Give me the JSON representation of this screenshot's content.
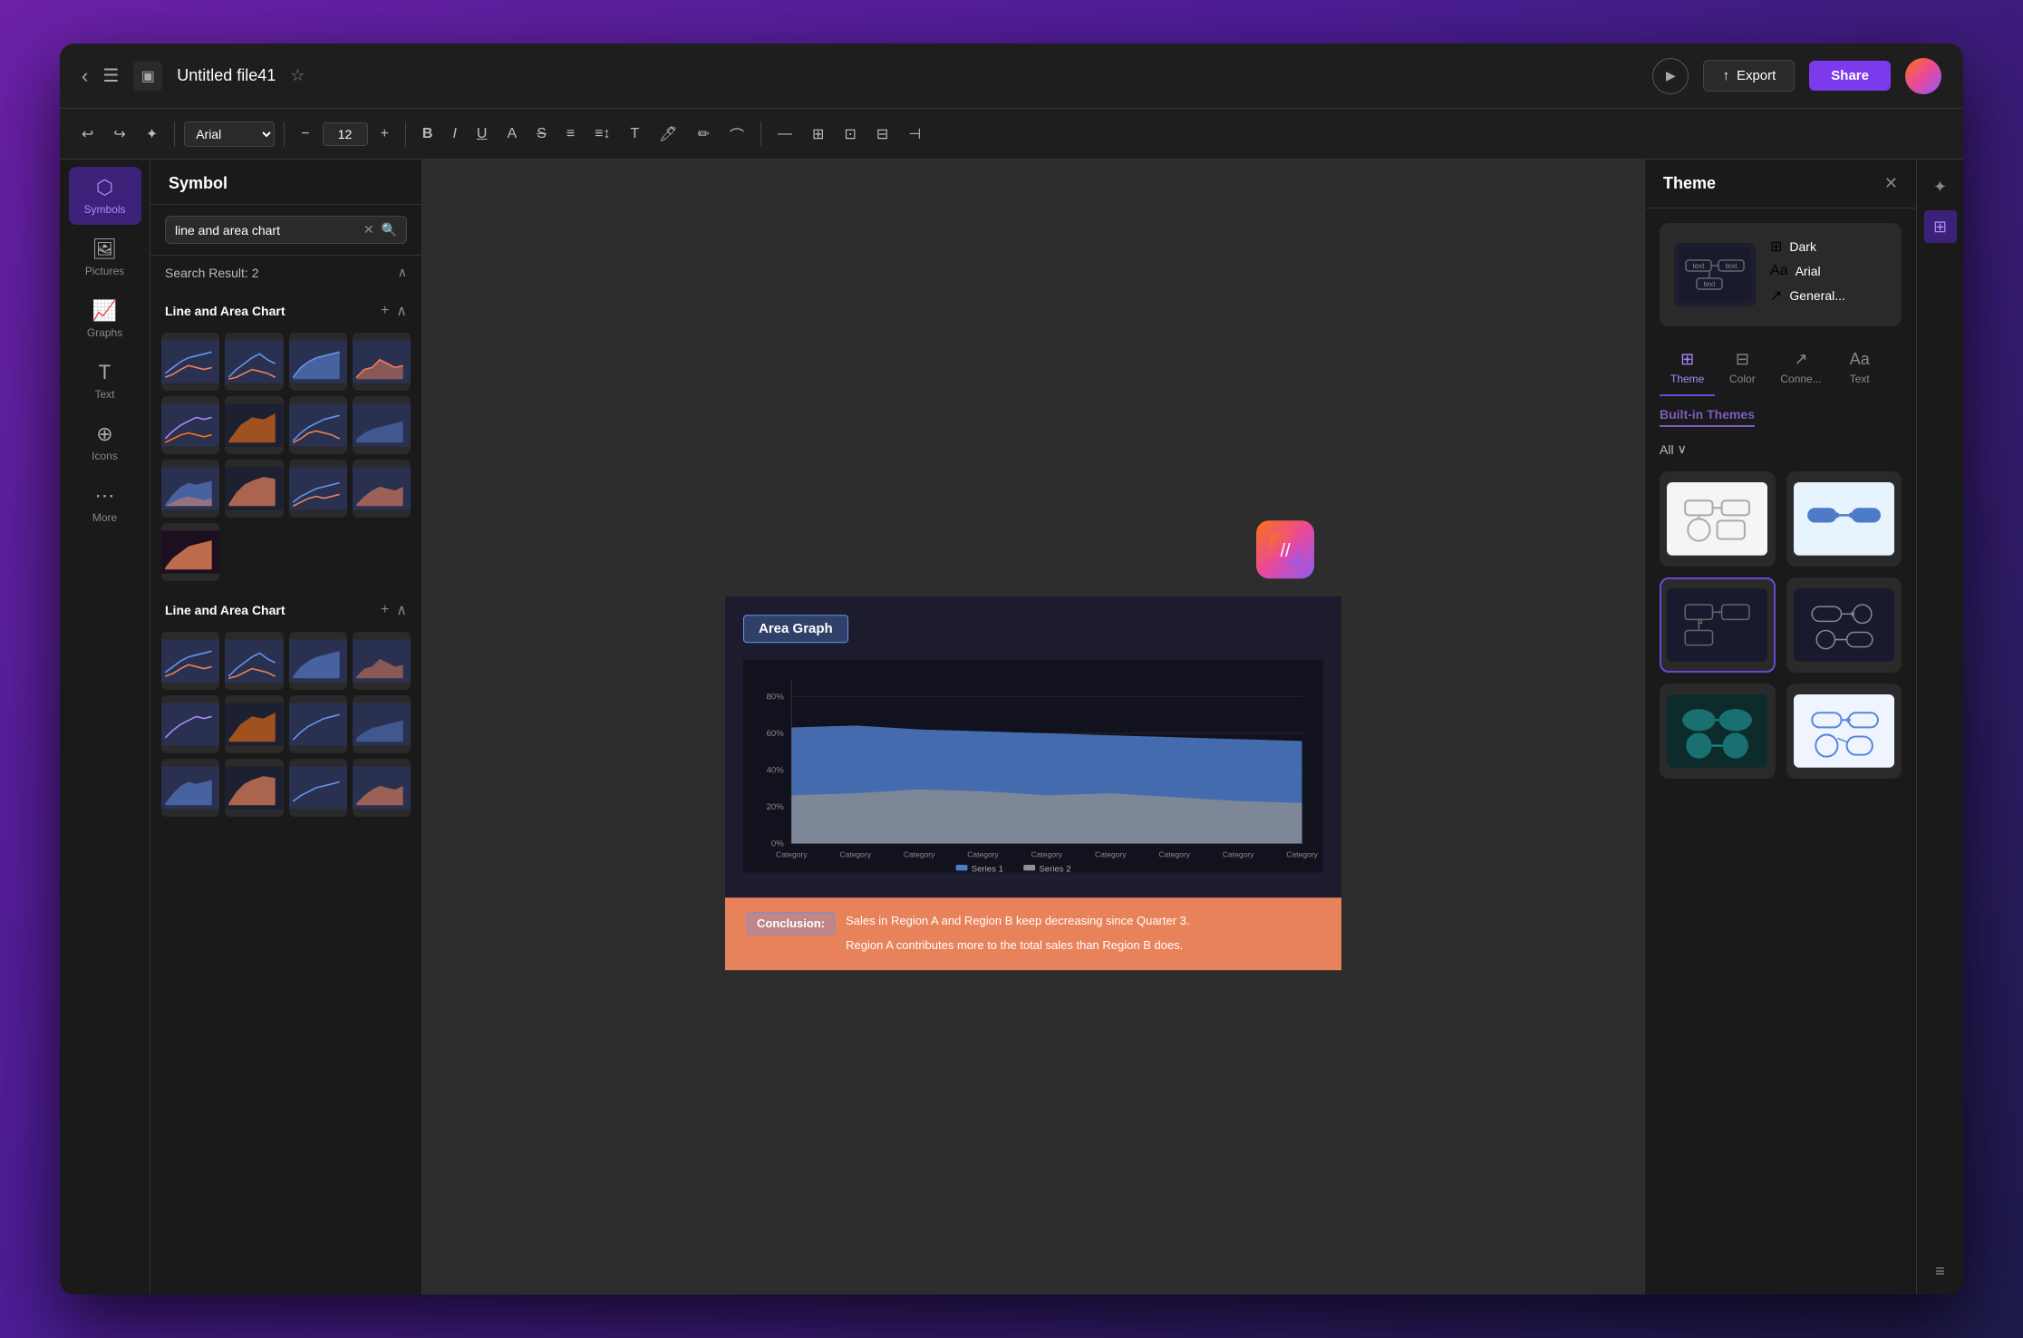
{
  "app": {
    "title": "Untitled file41",
    "window_title": "Untitled file41"
  },
  "titlebar": {
    "back_label": "‹",
    "menu_label": "☰",
    "file_title": "Untitled file41",
    "export_label": "Export",
    "share_label": "Share",
    "play_label": "▶"
  },
  "toolbar": {
    "undo_label": "↩",
    "redo_label": "↪",
    "magic_label": "✦",
    "font_value": "Arial",
    "font_size_value": "12",
    "bold_label": "B",
    "italic_label": "I",
    "underline_label": "U",
    "text_color_label": "A",
    "strikethrough_label": "S",
    "align_label": "≡",
    "indent_label": "⇥",
    "textbox_label": "T"
  },
  "left_nav": {
    "items": [
      {
        "id": "symbols",
        "icon": "⬡",
        "label": "Symbols",
        "active": true
      },
      {
        "id": "pictures",
        "icon": "🖼",
        "label": "Pictures",
        "active": false
      },
      {
        "id": "graphs",
        "icon": "📊",
        "label": "Graphs",
        "active": false
      },
      {
        "id": "text",
        "icon": "T",
        "label": "Text",
        "active": false
      },
      {
        "id": "icons",
        "icon": "⊕",
        "label": "Icons",
        "active": false
      },
      {
        "id": "more",
        "icon": "⋯",
        "label": "More",
        "active": false
      }
    ]
  },
  "symbol_panel": {
    "header": "Symbol",
    "search_value": "line and area chart",
    "search_placeholder": "line and area chart",
    "result_count": "Search Result: 2",
    "sections": [
      {
        "title": "Line and Area Chart",
        "id": "section1"
      },
      {
        "title": "Line and Area Chart",
        "id": "section2"
      }
    ]
  },
  "canvas": {
    "chart_title": "Area Graph",
    "conclusion_label": "Conclusion:",
    "conclusion_text": "Sales in Region A and Region B keep decreasing since Quarter 3.\n\nRegion A contributes more to the total sales than Region B does."
  },
  "theme_panel": {
    "title": "Theme",
    "close_label": "✕",
    "theme_name": "Dark",
    "font_name": "Arial",
    "connector_label": "General...",
    "tabs": [
      {
        "id": "theme",
        "icon": "⊞",
        "label": "Theme",
        "active": true
      },
      {
        "id": "color",
        "icon": "⊟",
        "label": "Color",
        "active": false
      },
      {
        "id": "connector",
        "icon": "↗",
        "label": "Conne...",
        "active": false
      },
      {
        "id": "text",
        "icon": "Aa",
        "label": "Text",
        "active": false
      }
    ],
    "builtin_themes_label": "Built-in Themes",
    "filter_label": "All",
    "themes": [
      {
        "id": "default_light",
        "selected": false,
        "style": "light_simple"
      },
      {
        "id": "default_blue",
        "selected": false,
        "style": "blue_connected"
      },
      {
        "id": "dark_simple",
        "selected": true,
        "style": "dark_simple"
      },
      {
        "id": "dark_rounded",
        "selected": false,
        "style": "dark_rounded"
      },
      {
        "id": "teal_organic",
        "selected": false,
        "style": "teal_organic"
      },
      {
        "id": "blue_clean",
        "selected": false,
        "style": "blue_clean"
      }
    ]
  }
}
